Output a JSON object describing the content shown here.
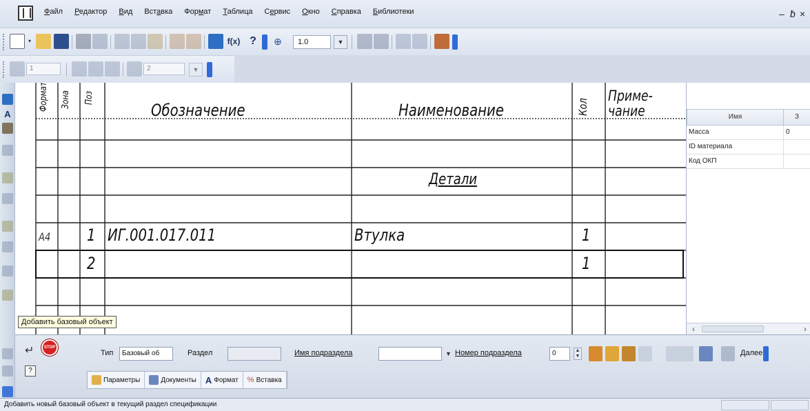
{
  "menubar": {
    "items": [
      "Файл",
      "Редактор",
      "Вид",
      "Вставка",
      "Формат",
      "Таблица",
      "Сервис",
      "Окно",
      "Справка",
      "Библиотеки"
    ],
    "underlines": [
      "Ф",
      "Р",
      "В",
      "а",
      "м",
      "Т",
      "е",
      "О",
      "С",
      "Б"
    ],
    "window_controls": [
      "–",
      "ƀ",
      "×"
    ]
  },
  "toolbar": {
    "zoom_value": "1.0",
    "fx_label": "f(x)",
    "position_field": "1",
    "page_field": "2"
  },
  "spec": {
    "headers": {
      "format": "Формат",
      "zone": "Зона",
      "pos": "Поз",
      "designation": "Обозначение",
      "name": "Наименование",
      "qty": "Кол",
      "note": "Приме-\nчание"
    },
    "section_title": "Детали",
    "rows": [
      {
        "format": "А4",
        "pos": "1",
        "designation": "ИГ.001.017.011",
        "name": "Втулка",
        "qty": "1"
      },
      {
        "format": "",
        "pos": "2",
        "designation": "",
        "name": "",
        "qty": "1"
      }
    ]
  },
  "props": {
    "headers": [
      "Имя",
      "З"
    ],
    "rows": [
      {
        "name": "Масса",
        "value": "0"
      },
      {
        "name": "ID материала",
        "value": ""
      },
      {
        "name": "Код ОКП",
        "value": ""
      }
    ]
  },
  "tooltip": "Добавить базовый объект",
  "property_manager": {
    "type_label": "Тип",
    "type_value": "Базовый об",
    "section_label": "Раздел",
    "section_value": "",
    "subsection_name_label": "Имя подраздела",
    "subsection_number_label": "Номер подраздела",
    "subsection_number_value": "0",
    "cut_label": "Далее",
    "help_icon": "?",
    "tabs": [
      "Параметры",
      "Документы",
      "Формат",
      "Вставка"
    ]
  },
  "status": {
    "text": "Добавить новый базовый объект в текущий раздел спецификации"
  },
  "colors": {
    "chrome_blue": "#2f6bd6",
    "stop_red": "#d82020",
    "tooltip_bg": "#ffffe1"
  }
}
